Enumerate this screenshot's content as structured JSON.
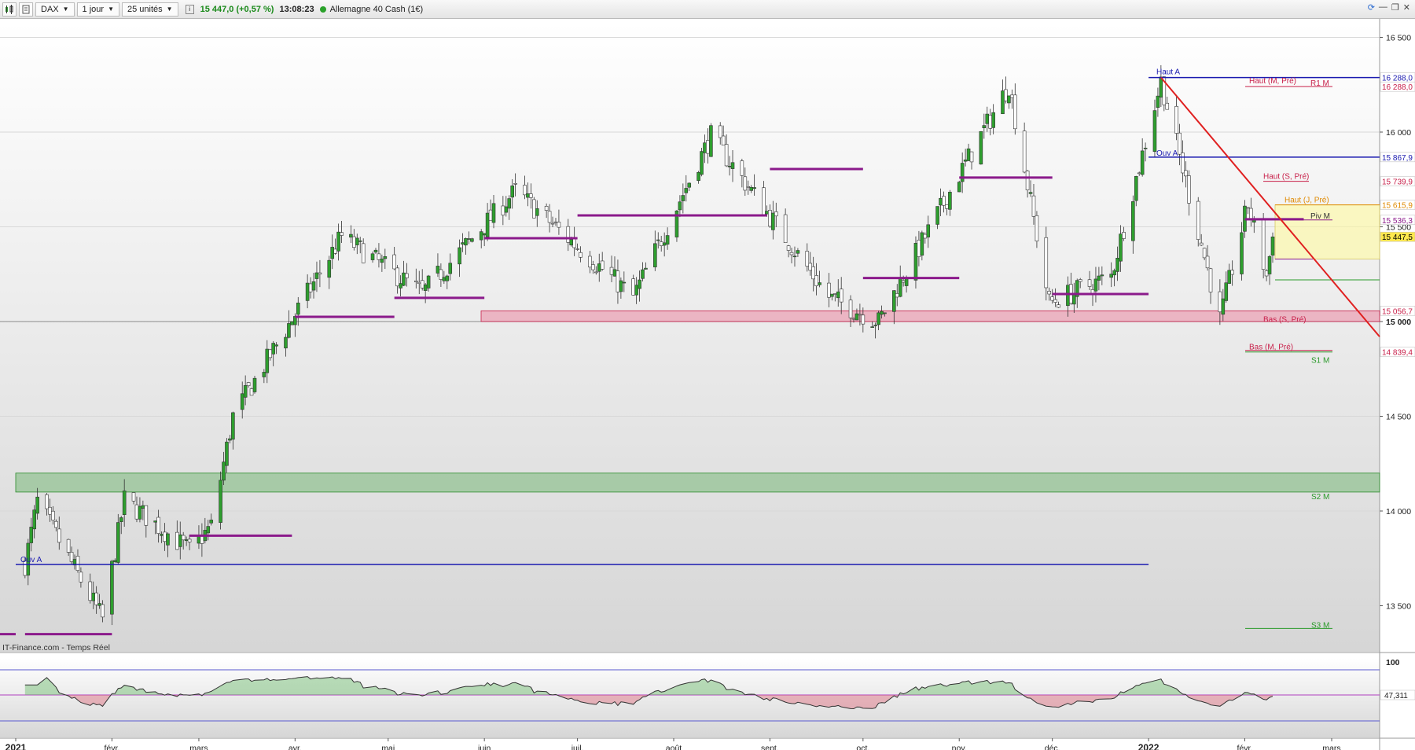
{
  "toolbar": {
    "symbol": "DAX",
    "interval": "1 jour",
    "units": "25 unités",
    "last_price": "15 447,0",
    "change": "(+0,57 %)",
    "time": "13:08:23",
    "instrument": "Allemagne 40 Cash (1€)"
  },
  "source": "IT-Finance.com - Temps Réel",
  "colors": {
    "up_candle": "#2e9e2e",
    "down_candle": "#ffffff",
    "pivot_lines": "#8b1a8b",
    "trendline": "#e02020",
    "blue_level": "#1b1bb0",
    "resistance": "#c8204a",
    "support": "#2a9a2a",
    "rsi_line": "#333333"
  },
  "chart_data": {
    "type": "candlestick",
    "title": "DAX",
    "x_ticks": [
      "2021",
      "févr.",
      "mars",
      "avr.",
      "mai",
      "juin",
      "juil.",
      "août",
      "sept.",
      "oct.",
      "nov.",
      "déc.",
      "2022",
      "févr.",
      "mars"
    ],
    "y_ticks": [
      "16 500",
      "16 000",
      "15 500",
      "15 000",
      "14 500",
      "14 000",
      "13 500"
    ],
    "ylim": [
      13200,
      16700
    ],
    "daily_close_checkpoints": [
      {
        "date": "2021-01-04",
        "close": 13720
      },
      {
        "date": "2021-01-08",
        "close": 14050
      },
      {
        "date": "2021-01-29",
        "close": 13430
      },
      {
        "date": "2021-02-05",
        "close": 14060
      },
      {
        "date": "2021-02-26",
        "close": 13790
      },
      {
        "date": "2021-03-05",
        "close": 13920
      },
      {
        "date": "2021-03-12",
        "close": 14500
      },
      {
        "date": "2021-03-31",
        "close": 15010
      },
      {
        "date": "2021-04-16",
        "close": 15450
      },
      {
        "date": "2021-05-12",
        "close": 15150
      },
      {
        "date": "2021-06-11",
        "close": 15690
      },
      {
        "date": "2021-07-19",
        "close": 15130
      },
      {
        "date": "2021-08-13",
        "close": 15980
      },
      {
        "date": "2021-09-20",
        "close": 15130
      },
      {
        "date": "2021-10-06",
        "close": 15000
      },
      {
        "date": "2021-11-17",
        "close": 16250
      },
      {
        "date": "2021-11-30",
        "close": 15100
      },
      {
        "date": "2021-12-20",
        "close": 15240
      },
      {
        "date": "2022-01-05",
        "close": 16270
      },
      {
        "date": "2022-01-24",
        "close": 15010
      },
      {
        "date": "2022-02-02",
        "close": 15620
      },
      {
        "date": "2022-02-08",
        "close": 15240
      },
      {
        "date": "2022-02-10",
        "close": 15447
      }
    ],
    "price_labels": [
      {
        "text": "16 288,0",
        "value": 16288,
        "color": "#1b1bb0"
      },
      {
        "text": "16 288,0",
        "value": 16240,
        "color": "#c8204a"
      },
      {
        "text": "15 867,9",
        "value": 15867.9,
        "color": "#1b1bb0"
      },
      {
        "text": "15 739,9",
        "value": 15739.9,
        "color": "#c8204a"
      },
      {
        "text": "15 615,9",
        "value": 15615.9,
        "color": "#e08a00"
      },
      {
        "text": "15 536,3",
        "value": 15536.3,
        "color": "#8b1a8b"
      },
      {
        "text": "15 447,5",
        "value": 15447.5,
        "color": "#000000"
      },
      {
        "text": "15 056,7",
        "value": 15056.7,
        "color": "#c8204a"
      },
      {
        "text": "14 839,4",
        "value": 14839.4,
        "color": "#c8204a"
      }
    ],
    "level_annotations": [
      {
        "text": "Haut A",
        "value": 16288,
        "color": "#1b1bb0"
      },
      {
        "text": "Haut (M, Pré)",
        "value": 16240,
        "color": "#c8204a"
      },
      {
        "text": "R1 M",
        "value": 16240,
        "color": "#c8204a"
      },
      {
        "text": "Ouv A",
        "value": 15867.9,
        "color": "#1b1bb0"
      },
      {
        "text": "Haut (S, Pré)",
        "value": 15739.9,
        "color": "#c8204a"
      },
      {
        "text": "Haut (J, Pré)",
        "value": 15615.9,
        "color": "#e08a00"
      },
      {
        "text": "Piv M",
        "value": 15536.3,
        "color": "#333333"
      },
      {
        "text": "Bas (S, Pré)",
        "value": 15056.7,
        "color": "#c8204a"
      },
      {
        "text": "Bas (M, Pré)",
        "value": 14839.4,
        "color": "#c8204a"
      },
      {
        "text": "S1 M",
        "value": 14839.4,
        "color": "#2a9a2a"
      },
      {
        "text": "S2 M",
        "value": 14120,
        "color": "#2a9a2a"
      },
      {
        "text": "S3 M",
        "value": 13380,
        "color": "#2a9a2a"
      },
      {
        "text": "Ouv A",
        "value": 13718,
        "color": "#1b1bb0"
      }
    ],
    "zones": [
      {
        "name": "support-zone-green",
        "from": 14100,
        "to": 14200
      },
      {
        "name": "support-zone-pink",
        "from": 15000,
        "to": 15056.7
      },
      {
        "name": "range-zone-yellow",
        "from": 15330,
        "to": 15615.9
      }
    ],
    "rsi": {
      "upper_label": "100",
      "last_label": "47,311",
      "last_value": 47.311
    }
  }
}
